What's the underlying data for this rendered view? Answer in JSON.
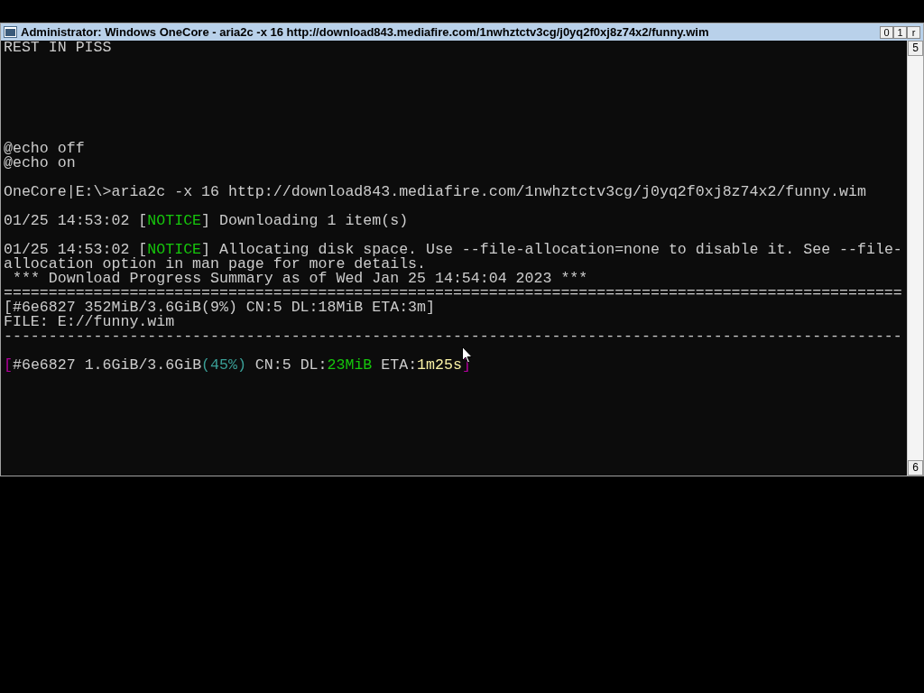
{
  "window": {
    "title": "Administrator:  Windows OneCore - aria2c  -x 16 http://download843.mediafire.com/1nwhztctv3cg/j0yq2f0xj8z74x2/funny.wim",
    "title_buttons": [
      "0",
      "1",
      "r"
    ]
  },
  "console": {
    "lines": [
      {
        "kind": "text",
        "segments": [
          {
            "text": "REST IN PISS",
            "color": "#cccccc"
          }
        ]
      },
      {
        "kind": "blank"
      },
      {
        "kind": "blank"
      },
      {
        "kind": "blank"
      },
      {
        "kind": "blank"
      },
      {
        "kind": "blank"
      },
      {
        "kind": "blank"
      },
      {
        "kind": "text",
        "segments": [
          {
            "text": "@echo off",
            "color": "#cccccc"
          }
        ]
      },
      {
        "kind": "text",
        "segments": [
          {
            "text": "@echo on",
            "color": "#cccccc"
          }
        ]
      },
      {
        "kind": "blank"
      },
      {
        "kind": "text",
        "segments": [
          {
            "text": "OneCore|E:\\>aria2c -x 16 http://download843.mediafire.com/1nwhztctv3cg/j0yq2f0xj8z74x2/funny.wim",
            "color": "#cccccc"
          }
        ]
      },
      {
        "kind": "blank"
      },
      {
        "kind": "text",
        "segments": [
          {
            "text": "01/25 14:53:02 [",
            "color": "#cccccc"
          },
          {
            "text": "NOTICE",
            "color": "#16c60c"
          },
          {
            "text": "] Downloading 1 item(s)",
            "color": "#cccccc"
          }
        ]
      },
      {
        "kind": "blank"
      },
      {
        "kind": "text",
        "segments": [
          {
            "text": "01/25 14:53:02 [",
            "color": "#cccccc"
          },
          {
            "text": "NOTICE",
            "color": "#16c60c"
          },
          {
            "text": "] Allocating disk space. Use --file-allocation=none to disable it. See --file-allocation option in man page for more details.",
            "color": "#cccccc"
          }
        ]
      },
      {
        "kind": "text",
        "segments": [
          {
            "text": " *** Download Progress Summary as of Wed Jan 25 14:54:04 2023 ***",
            "color": "#cccccc"
          }
        ]
      },
      {
        "kind": "text",
        "segments": [
          {
            "text": "====================================================================================================",
            "color": "#cccccc"
          }
        ]
      },
      {
        "kind": "text",
        "segments": [
          {
            "text": "[#6e6827 352MiB/3.6GiB(9%) CN:5 DL:18MiB ETA:3m]",
            "color": "#cccccc"
          }
        ]
      },
      {
        "kind": "text",
        "segments": [
          {
            "text": "FILE: E://funny.wim",
            "color": "#cccccc"
          }
        ]
      },
      {
        "kind": "text",
        "segments": [
          {
            "text": "----------------------------------------------------------------------------------------------------",
            "color": "#cccccc"
          }
        ]
      },
      {
        "kind": "blank"
      },
      {
        "kind": "text",
        "segments": [
          {
            "text": "[",
            "color": "#b4009e"
          },
          {
            "text": "#6e6827 1.6GiB/3.6GiB",
            "color": "#cccccc"
          },
          {
            "text": "(45%)",
            "color": "#3a9e96"
          },
          {
            "text": " CN:5 DL:",
            "color": "#cccccc"
          },
          {
            "text": "23MiB",
            "color": "#16c60c"
          },
          {
            "text": " ETA:",
            "color": "#cccccc"
          },
          {
            "text": "1m25s",
            "color": "#f9f1a5"
          },
          {
            "text": "]",
            "color": "#b4009e"
          }
        ]
      }
    ]
  },
  "scrollbar": {
    "up_label": "5",
    "down_label": "6"
  }
}
